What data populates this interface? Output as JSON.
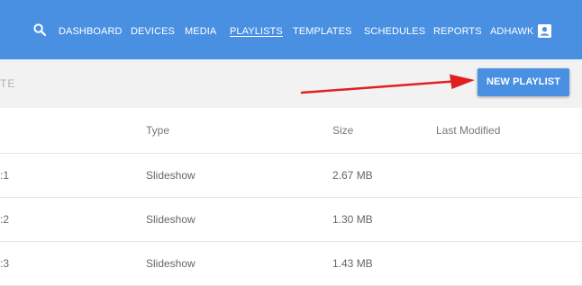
{
  "nav": {
    "items": [
      {
        "label": "DASHBOARD",
        "active": false
      },
      {
        "label": "DEVICES",
        "active": false
      },
      {
        "label": "MEDIA",
        "active": false
      },
      {
        "label": "PLAYLISTS",
        "active": true
      },
      {
        "label": "TEMPLATES",
        "active": false
      },
      {
        "label": "SCHEDULES",
        "active": false
      },
      {
        "label": "REPORTS",
        "active": false
      },
      {
        "label": "ADHAWK",
        "active": false
      }
    ],
    "icons": {
      "search": "search-icon",
      "account": "account-box-icon"
    }
  },
  "toolbar": {
    "partial_text": "TE",
    "new_playlist_label": "NEW PLAYLIST"
  },
  "annotation": {
    "arrow_color": "#e02020"
  },
  "table": {
    "headers": {
      "type": "Type",
      "size": "Size",
      "last_modified": "Last Modified"
    },
    "rows": [
      {
        "name": ":1",
        "type": "Slideshow",
        "size": "2.67 MB",
        "last_modified": ""
      },
      {
        "name": ":2",
        "type": "Slideshow",
        "size": "1.30 MB",
        "last_modified": ""
      },
      {
        "name": ":3",
        "type": "Slideshow",
        "size": "1.43 MB",
        "last_modified": ""
      }
    ]
  },
  "colors": {
    "primary": "#4a90e2",
    "toolbar_bg": "#f2f2f2"
  }
}
